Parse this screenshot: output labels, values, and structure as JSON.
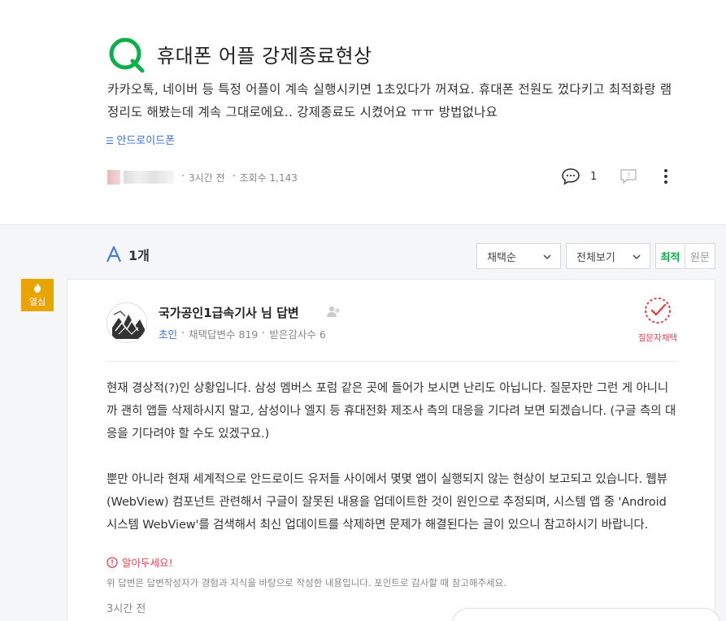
{
  "question": {
    "title": "휴대폰 어플 강제종료현상",
    "body": "카카오톡, 네이버 등 특정 어플이 계속 실행시키면 1초있다가 꺼져요. 휴대폰 전원도 껐다키고 최적화랑 램정리도 해봤는데 계속 그대로에요.. 강제종료도 시켰어요 ㅠㅠ 방법없나요",
    "category": "안드로이드폰",
    "time": "3시간 전",
    "views": "조회수 1,143",
    "comment_count": "1"
  },
  "answers_header": {
    "count": "1개",
    "sort_select": "채택순",
    "view_select": "전체보기",
    "sort_latest": "최적",
    "sort_original": "원문"
  },
  "badge": {
    "label": "열심"
  },
  "answer": {
    "author": "국가공인1급속기사 님 답변",
    "grade": "초인",
    "adopted_count": "채택답변수 819",
    "thanks_count": "받은감사수 6",
    "questioner_choice": "질문자채택",
    "paragraph1": "현재 경상적(?)인 상황입니다. 삼성 멤버스 포럼 같은 곳에 들어가 보시면 난리도 아닙니다. 질문자만 그런 게 아니니까 괜히 앱들 삭제하시지 말고, 삼성이나 엘지 등 휴대전화 제조사 측의 대응을 기다려 보면 되겠습니다. (구글 측의 대응을 기다려야 할 수도 있겠구요.)",
    "paragraph2": "뿐만 아니라 현재 세계적으로 안드로이드 유저들 사이에서 몇몇 앱이 실행되지 않는 현상이 보고되고 있습니다. 웹뷰(WebView) 컴포넌트 관련해서 구글이 잘못된 내용을 업데이트한 것이 원인으로 추정되며, 시스템 앱 중 'Android 시스템 WebView'를 검색해서 최신 업데이트를 삭제하면 문제가 해결된다는 글이 있으니 참고하시기 바랍니다.",
    "notice_title": "알아두세요!",
    "notice_text": "위 답변은 답변작성자가 경험과 지식을 바탕으로 작성한 내용입니다. 포인트로 감사할 때 참고해주세요.",
    "time": "3시간 전"
  },
  "colors": {
    "brand_green": "#0cb04a",
    "link_blue": "#3a6fd8",
    "alert_red": "#e8454f",
    "badge_orange": "#e8a500"
  }
}
